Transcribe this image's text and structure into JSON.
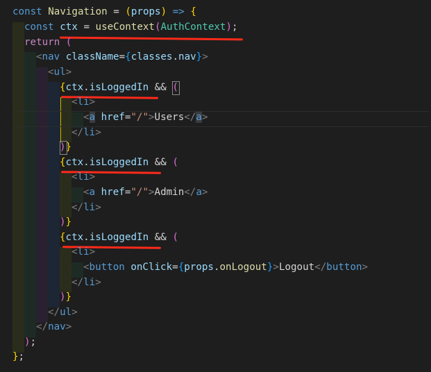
{
  "code": {
    "l1": {
      "kw": "const",
      "name": "Navigation",
      "eq": "=",
      "param": "props",
      "arrow": "=>",
      "open": "{"
    },
    "l2": {
      "kw": "const",
      "var": "ctx",
      "eq": "=",
      "fn": "useContext",
      "arg": "AuthContext",
      "end": ";"
    },
    "l3": {
      "kw": "return",
      "open": "("
    },
    "l4": {
      "tag": "nav",
      "attr": "className",
      "expr1": "classes",
      "expr2": "nav"
    },
    "l5": {
      "tag": "ul"
    },
    "l6": {
      "obj": "ctx",
      "prop": "isLoggedIn",
      "op": "&&"
    },
    "l7": {
      "tag": "li"
    },
    "l8": {
      "tag": "a",
      "attr": "href",
      "val": "\"/\"",
      "text": "Users"
    },
    "l9": {
      "tag": "li"
    },
    "l10": {
      "close": "}"
    },
    "l11": {
      "obj": "ctx",
      "prop": "isLoggedIn",
      "op": "&&"
    },
    "l12": {
      "tag": "li"
    },
    "l13": {
      "tag": "a",
      "attr": "href",
      "val": "\"/\"",
      "text": "Admin"
    },
    "l14": {
      "tag": "li"
    },
    "l15": {
      "close": "}"
    },
    "l16": {
      "obj": "ctx",
      "prop": "isLoggedIn",
      "op": "&&"
    },
    "l17": {
      "tag": "li"
    },
    "l18": {
      "tag": "button",
      "attr": "onClick",
      "expr1": "props",
      "expr2": "onLogout",
      "text": "Logout"
    },
    "l19": {
      "tag": "li"
    },
    "l20": {
      "close": "}"
    },
    "l21": {
      "tag": "ul"
    },
    "l22": {
      "tag": "nav"
    },
    "l23": {
      "end": ");"
    },
    "l24": {
      "end": "};"
    }
  },
  "colors": {
    "background": "#1e1e1e",
    "keyword": "#569cd6",
    "variable": "#9cdcfe",
    "function": "#dcdcaa",
    "type": "#4ec9b0",
    "string": "#ce9178",
    "annotation": "#ff2a1a"
  }
}
